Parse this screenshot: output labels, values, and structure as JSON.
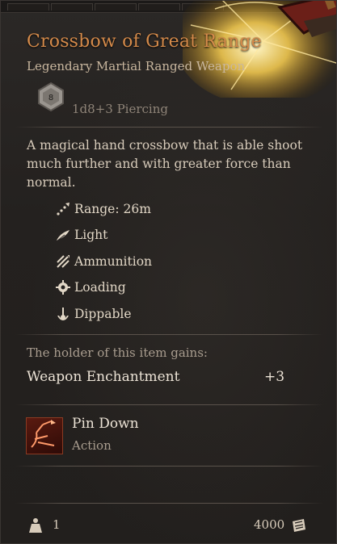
{
  "item": {
    "name": "Crossbow of Great Range",
    "subtitle": "Legendary Martial Ranged Weapon",
    "damage_die": "8",
    "damage": "1d8+3 Piercing",
    "description": "A magical hand crossbow that is able shoot much further and with greater force than normal.",
    "properties": [
      {
        "icon": "range-icon",
        "label": "Range: 26m"
      },
      {
        "icon": "feather-icon",
        "label": "Light"
      },
      {
        "icon": "ammunition-icon",
        "label": "Ammunition"
      },
      {
        "icon": "gear-icon",
        "label": "Loading"
      },
      {
        "icon": "dip-icon",
        "label": "Dippable"
      }
    ]
  },
  "grants": {
    "header": "The holder of this item gains:",
    "enchantment_label": "Weapon Enchantment",
    "enchantment_value": "+3"
  },
  "action": {
    "name": "Pin Down",
    "type": "Action",
    "icon": "pin-down-icon"
  },
  "footer": {
    "weight": "1",
    "weight_icon": "weight-icon",
    "price": "4000",
    "price_icon": "gold-coin-icon"
  },
  "colors": {
    "title": "#d48a4a",
    "subtitle": "#c9b79f",
    "body_text": "#d8ccbb",
    "muted": "#a99d8f",
    "background": "#24211f"
  }
}
